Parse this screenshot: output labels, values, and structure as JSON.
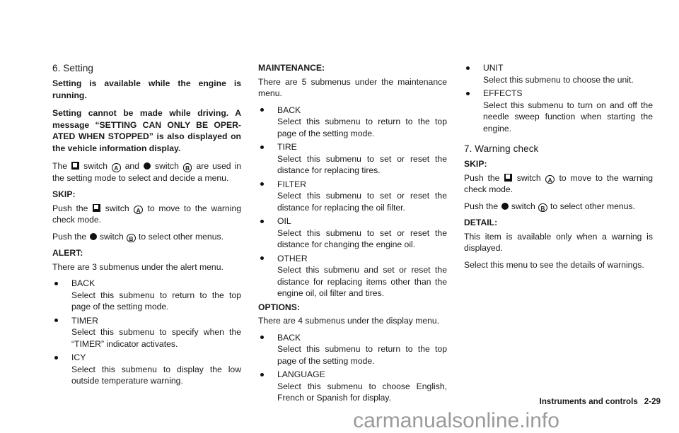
{
  "page": {
    "footer_title": "Instruments and controls",
    "footer_page": "2-29",
    "watermark": "carmanualsonline.info"
  },
  "icons": {
    "square_switch": "square-switch-icon",
    "round_switch": "round-switch-icon",
    "label_a": "A",
    "label_b": "B"
  },
  "left_column": {
    "section_heading": "6. Setting",
    "bold_para_1": "Setting is available while the engine is running.",
    "bold_para_2": "Setting cannot be made while driving. A message “SETTING CAN ONLY BE OPER-ATED WHEN STOPPED” is also displayed on the vehicle information display.",
    "switch_para": {
      "t1": "The",
      "t2": "switch",
      "t3": "and",
      "t4": "switch",
      "t5": "are used in the setting mode to select and decide a menu."
    },
    "skip": {
      "heading": "SKIP:",
      "line1_t1": "Push the",
      "line1_t2": "switch",
      "line1_t3": "to move to the warning check mode.",
      "line2_t1": "Push the",
      "line2_t2": "switch",
      "line2_t3": "to select other menus."
    },
    "alert": {
      "heading": "ALERT:",
      "intro": "There are 3 submenus under the alert menu.",
      "items": [
        {
          "title": "BACK",
          "desc": "Select this submenu to return to the top page of the setting mode."
        },
        {
          "title": "TIMER",
          "desc": "Select this submenu to specify when the “TIMER” indicator activates."
        },
        {
          "title": "ICY",
          "desc": "Select this submenu to display the low outside temperature warning."
        }
      ]
    }
  },
  "middle_column": {
    "maintenance": {
      "heading": "MAINTENANCE:",
      "intro": "There are 5 submenus under the maintenance menu.",
      "items": [
        {
          "title": "BACK",
          "desc": "Select this submenu to return to the top page of the setting mode."
        },
        {
          "title": "TIRE",
          "desc": "Select this submenu to set or reset the distance for replacing tires."
        },
        {
          "title": "FILTER",
          "desc": "Select this submenu to set or reset the distance for replacing the oil filter."
        },
        {
          "title": "OIL",
          "desc": "Select this submenu to set or reset the distance for changing the engine oil."
        },
        {
          "title": "OTHER",
          "desc": "Select this submenu and set or reset the distance for replacing items other than the engine oil, oil filter and tires."
        }
      ]
    },
    "options": {
      "heading": "OPTIONS:",
      "intro": "There are 4 submenus under the display menu.",
      "items": [
        {
          "title": "BACK",
          "desc": "Select this submenu to return to the top page of the setting mode."
        },
        {
          "title": "LANGUAGE",
          "desc": "Select this submenu to choose English, French or Spanish for display."
        }
      ]
    }
  },
  "right_column": {
    "options_continued": [
      {
        "title": "UNIT",
        "desc": "Select this submenu to choose the unit."
      },
      {
        "title": "EFFECTS",
        "desc": "Select this submenu to turn on and off the needle sweep function when starting the engine."
      }
    ],
    "section_heading": "7. Warning check",
    "skip": {
      "heading": "SKIP:",
      "line1_t1": "Push the",
      "line1_t2": "switch",
      "line1_t3": "to move to the warning check mode.",
      "line2_t1": "Push the",
      "line2_t2": "switch",
      "line2_t3": "to select other menus."
    },
    "detail": {
      "heading": "DETAIL:",
      "para1": "This item is available only when a warning is displayed.",
      "para2": "Select this menu to see the details of warnings."
    }
  }
}
